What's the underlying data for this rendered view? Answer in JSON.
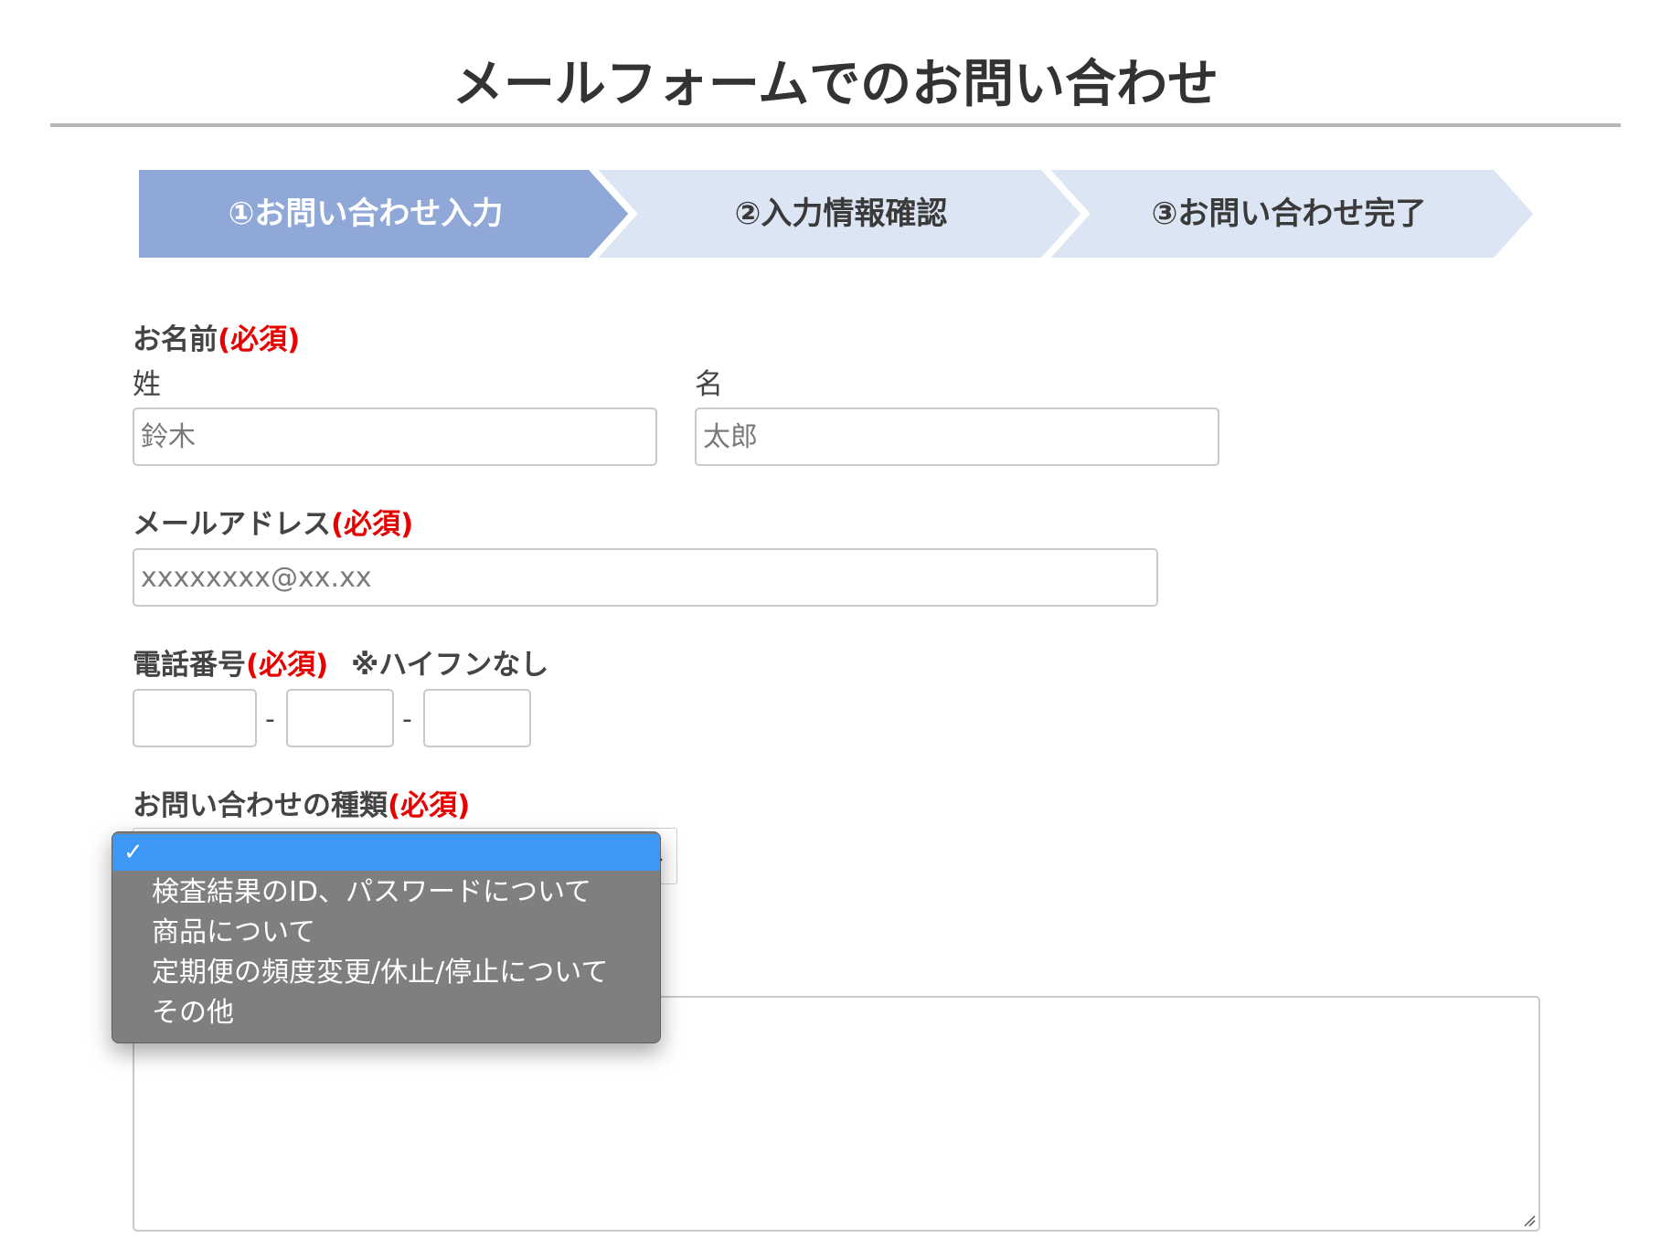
{
  "page": {
    "title": "メールフォームでのお問い合わせ"
  },
  "steps": [
    {
      "label": "①お問い合わせ入力",
      "active": true
    },
    {
      "label": "②入力情報確認",
      "active": false
    },
    {
      "label": "③お問い合わせ完了",
      "active": false
    }
  ],
  "colors": {
    "step_active": "#8fa8d7",
    "step_inactive": "#dce5f3",
    "required": "#e60000",
    "dropdown_bg": "#7f7f7f",
    "dropdown_selected": "#3d97f5"
  },
  "form": {
    "required_mark": "(必須)",
    "name": {
      "label": "お名前",
      "last_label": "姓",
      "first_label": "名",
      "last_placeholder": "鈴木",
      "first_placeholder": "太郎"
    },
    "email": {
      "label": "メールアドレス",
      "placeholder": "xxxxxxxx@xx.xx"
    },
    "phone": {
      "label": "電話番号",
      "note": "※ハイフンなし",
      "separator": "-"
    },
    "inquiry_type": {
      "label": "お問い合わせの種類",
      "selected_value": "",
      "options": [
        "",
        "検査結果のID、パスワードについて",
        "商品について",
        "定期便の頻度変更/休止/停止について",
        "その他"
      ]
    },
    "message": {
      "value": ""
    }
  },
  "icons": {
    "check": "checkmark-icon",
    "select_arrow": "chevron-down-icon",
    "resize": "resize-grip-icon"
  }
}
